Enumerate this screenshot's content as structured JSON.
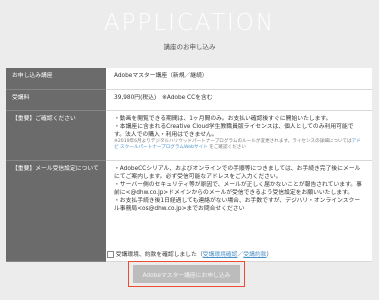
{
  "header": {
    "title": "APPLICATION",
    "subtitle": "講座のお申し込み"
  },
  "form": {
    "rows": [
      {
        "label": "お申し込み講座",
        "value": "Adobeマスター講座（新規／継続）"
      },
      {
        "label": "受講料",
        "value": "39,980円(税込)　※Adobe CCを含む"
      },
      {
        "label": "【重要】ご確認ください",
        "lines": [
          "・動画を閲覧できる期間は、1ヶ月間のみ。お支払い確認後すぐに開始いたします。",
          "・本講座に含まれるCreative Cloud学生教職員版ライセンスは、個人としてのみ利用可能です。法人での購入・利用はできません。"
        ],
        "note": "※2019年6月よりデジタルハリウッドパートナープログラムのルールが変更されます。ライセンスの詳細については",
        "note_link": "アドビ スクールパートナープログラムWebサイト",
        "note_tail": " をご確認ください"
      },
      {
        "label": "【重要】メール受信設定について",
        "lines": [
          "・AdobeCCシリアル、およびオンラインでの手順等につきましては、お手続き完了後にメールにてご案内します。必ず受信可能なアドレスをご入力ください。",
          "・サーバー側のセキュリティ等が原因で、メールが正しく届かないことが報告されています。事前に<@dhw.co.jp>ドメインからのメールが受信できるよう受信設定をお願いいたします。",
          "・お支払手続き後1日経過しても連絡がない場合、お手数ですが、デジハリ・オンラインスクール事務局<os@dhw.co.jp>までお問合せください"
        ]
      }
    ]
  },
  "agree": {
    "text": "受講環境、約款を確認しました（",
    "link1": "受講環境確認",
    "sep": "／",
    "link2": "受講約款",
    "close": "）"
  },
  "submit": {
    "label": "Adobeマスター講座にお申し込み"
  }
}
